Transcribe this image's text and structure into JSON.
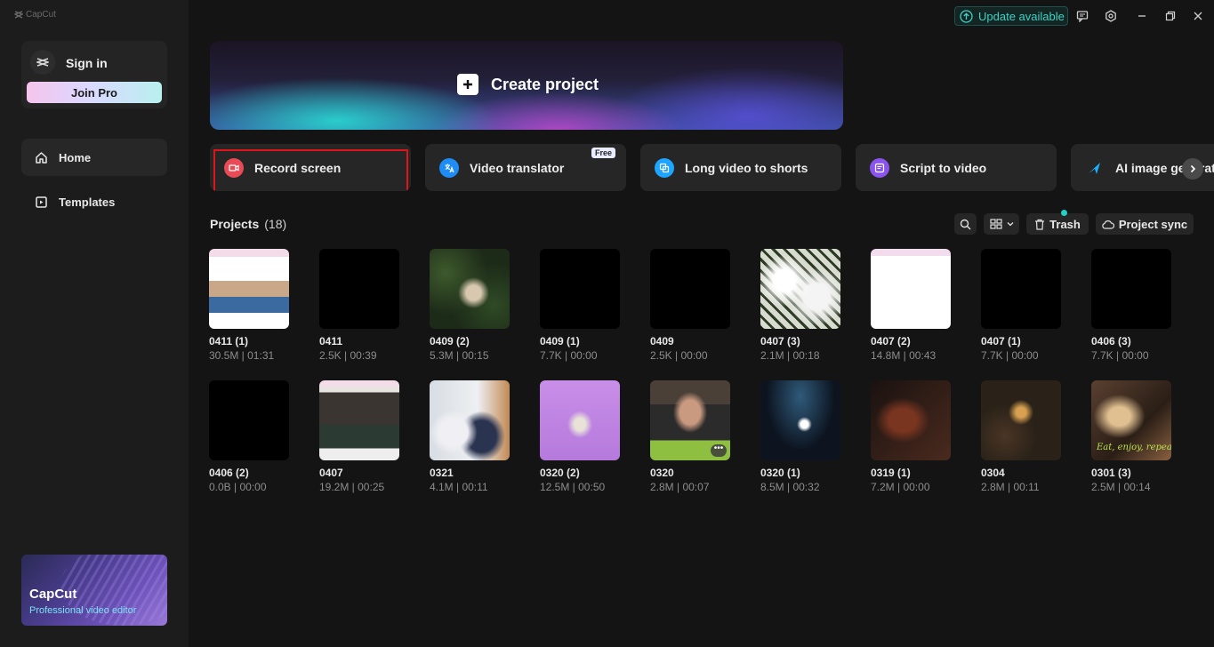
{
  "app": {
    "logo_text": "CapCut"
  },
  "sidebar": {
    "sign_in": "Sign in",
    "join_pro": "Join Pro",
    "items": [
      {
        "label": "Home",
        "icon": "home-icon",
        "active": true
      },
      {
        "label": "Templates",
        "icon": "templates-icon",
        "active": false
      }
    ],
    "promo": {
      "title": "CapCut",
      "subtitle": "Professional video editor"
    }
  },
  "topbar": {
    "update_label": "Update available",
    "icons": [
      "feedback-icon",
      "settings-icon",
      "minimize-icon",
      "restore-icon",
      "close-icon"
    ]
  },
  "hero": {
    "label": "Create project"
  },
  "tools": [
    {
      "label": "Record screen",
      "icon": "record-screen-icon",
      "color": "#e84b55",
      "highlighted": true
    },
    {
      "label": "Video translator",
      "icon": "translate-icon",
      "color": "#1d8cf5",
      "badge": "Free"
    },
    {
      "label": "Long video to shorts",
      "icon": "shorts-icon",
      "color": "#1ea5ff"
    },
    {
      "label": "Script to video",
      "icon": "script-icon",
      "color": "#8a55ee"
    },
    {
      "label": "AI image generator",
      "icon": "ai-image-icon",
      "color": "#1ab0ff"
    }
  ],
  "projects": {
    "title": "Projects",
    "count": "(18)",
    "trash_label": "Trash",
    "sync_label": "Project sync",
    "items": [
      {
        "name": "0411 (1)",
        "meta": "30.5M | 01:31",
        "thumb": "screenshot"
      },
      {
        "name": "0411",
        "meta": "2.5K | 00:39",
        "thumb": "black"
      },
      {
        "name": "0409 (2)",
        "meta": "5.3M | 00:15",
        "thumb": "vines"
      },
      {
        "name": "0409 (1)",
        "meta": "7.7K | 00:00",
        "thumb": "black"
      },
      {
        "name": "0409",
        "meta": "2.5K | 00:00",
        "thumb": "black"
      },
      {
        "name": "0407 (3)",
        "meta": "2.1M | 00:18",
        "thumb": "snow"
      },
      {
        "name": "0407 (2)",
        "meta": "14.8M | 00:43",
        "thumb": "white"
      },
      {
        "name": "0407 (1)",
        "meta": "7.7K | 00:00",
        "thumb": "black"
      },
      {
        "name": "0406 (3)",
        "meta": "7.7K | 00:00",
        "thumb": "black"
      },
      {
        "name": "0406 (2)",
        "meta": "0.0B | 00:00",
        "thumb": "black"
      },
      {
        "name": "0407",
        "meta": "19.2M | 00:25",
        "thumb": "room"
      },
      {
        "name": "0321",
        "meta": "4.1M | 00:11",
        "thumb": "kids"
      },
      {
        "name": "0320 (2)",
        "meta": "12.5M | 00:50",
        "thumb": "purple"
      },
      {
        "name": "0320",
        "meta": "2.8M | 00:07",
        "thumb": "man"
      },
      {
        "name": "0320 (1)",
        "meta": "8.5M | 00:32",
        "thumb": "stage"
      },
      {
        "name": "0319 (1)",
        "meta": "7.2M | 00:00",
        "thumb": "violin"
      },
      {
        "name": "0304",
        "meta": "2.8M | 00:11",
        "thumb": "party"
      },
      {
        "name": "0301 (3)",
        "meta": "2.5M | 00:14",
        "thumb": "restaurant",
        "overlay_text": "Eat, enjoy, repeat"
      }
    ]
  }
}
